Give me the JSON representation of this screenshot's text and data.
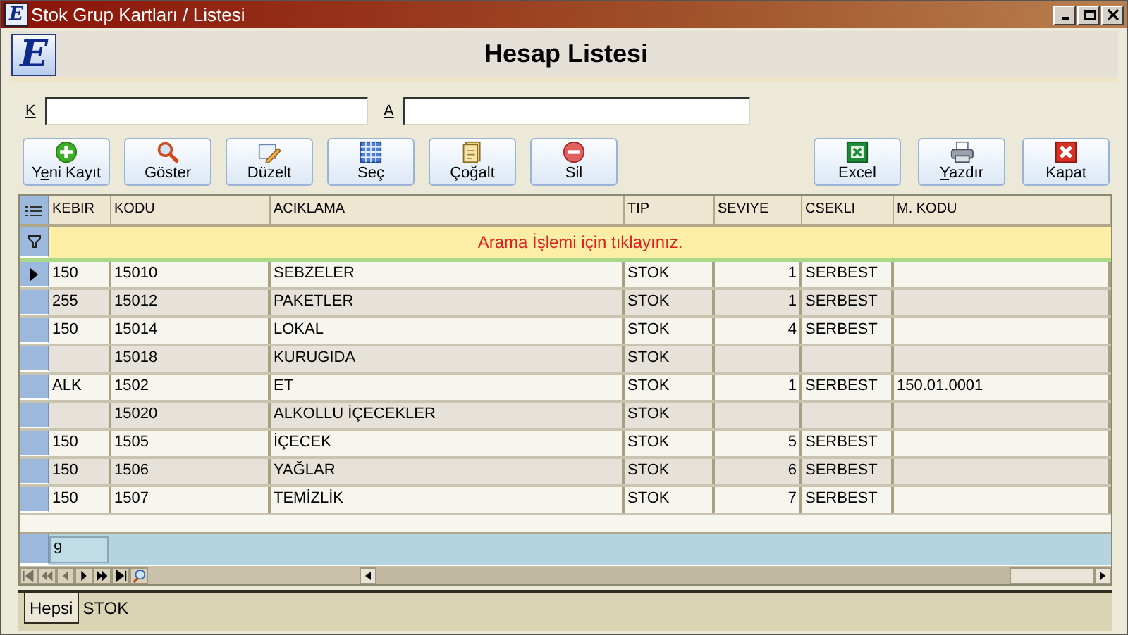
{
  "window": {
    "title": "Stok Grup Kartları / Listesi",
    "controls": [
      {
        "kind": "minimize"
      },
      {
        "kind": "maximize"
      },
      {
        "kind": "close"
      }
    ]
  },
  "app_icon": "E",
  "header": {
    "logo": "E",
    "title": "Hesap Listesi"
  },
  "filters": [
    {
      "label": "K"
    },
    {
      "label": "A"
    }
  ],
  "toolbar": {
    "left": [
      {
        "label": "Yeni Kayıt"
      },
      {
        "label": "Göster"
      },
      {
        "label": "Düzelt"
      },
      {
        "label": "Seç"
      },
      {
        "label": "Çoğalt"
      },
      {
        "label": "Sil"
      }
    ],
    "right": [
      {
        "label": "Excel"
      },
      {
        "label": "Yazdır"
      },
      {
        "label": "Kapat"
      }
    ]
  },
  "table": {
    "columns": [
      "KEBIR",
      "KODU",
      "ACIKLAMA",
      "TIP",
      "SEVIYE",
      "CSEKLI",
      "M. KODU"
    ],
    "search_hint": "Arama İşlemi için tıklayınız.",
    "rows": [
      {
        "cells": [
          "150",
          "15010",
          "SEBZELER",
          "STOK",
          "1",
          "SERBEST",
          ""
        ],
        "selected": true
      },
      {
        "cells": [
          "255",
          "15012",
          "PAKETLER",
          "STOK",
          "1",
          "SERBEST",
          ""
        ],
        "selected": false
      },
      {
        "cells": [
          "150",
          "15014",
          "LOKAL",
          "STOK",
          "4",
          "SERBEST",
          ""
        ],
        "selected": false
      },
      {
        "cells": [
          "",
          "15018",
          "KURUGIDA",
          "STOK",
          "",
          "",
          ""
        ],
        "selected": false
      },
      {
        "cells": [
          "ALK",
          "1502",
          "ET",
          "STOK",
          "1",
          "SERBEST",
          "150.01.0001"
        ],
        "selected": false
      },
      {
        "cells": [
          "",
          "15020",
          "ALKOLLU İÇECEKLER",
          "STOK",
          "",
          "",
          ""
        ],
        "selected": false
      },
      {
        "cells": [
          "150",
          "1505",
          "İÇECEK",
          "STOK",
          "5",
          "SERBEST",
          ""
        ],
        "selected": false
      },
      {
        "cells": [
          "150",
          "1506",
          "YAĞLAR",
          "STOK",
          "6",
          "SERBEST",
          ""
        ],
        "selected": false
      },
      {
        "cells": [
          "150",
          "1507",
          "TEMİZLİK",
          "STOK",
          "7",
          "SERBEST",
          ""
        ],
        "selected": false
      }
    ],
    "footer_count": "9",
    "navigator": [
      {
        "kind": "first",
        "disabled": true
      },
      {
        "kind": "prev-page",
        "disabled": true
      },
      {
        "kind": "prev",
        "disabled": true
      },
      {
        "kind": "next",
        "disabled": false
      },
      {
        "kind": "next-page",
        "disabled": false
      },
      {
        "kind": "last",
        "disabled": false
      },
      {
        "kind": "find",
        "disabled": false
      }
    ]
  },
  "tabs": [
    {
      "label": "Hepsi",
      "selected": true
    },
    {
      "label": "STOK",
      "selected": false
    }
  ]
}
